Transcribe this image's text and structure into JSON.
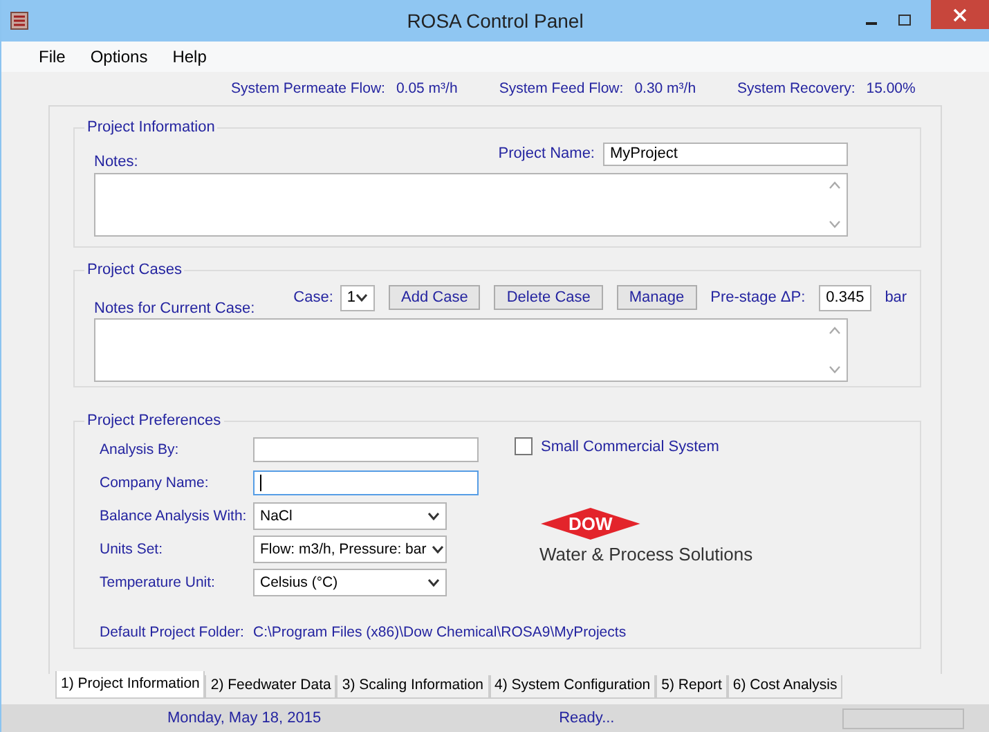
{
  "window": {
    "title": "ROSA Control Panel"
  },
  "menu": [
    "File",
    "Options",
    "Help"
  ],
  "summary": [
    {
      "label": "System Permeate Flow:",
      "value": "0.05 m³/h"
    },
    {
      "label": "System Feed Flow:",
      "value": "0.30 m³/h"
    },
    {
      "label": "System Recovery:",
      "value": "15.00%"
    }
  ],
  "project_information": {
    "title": "Project Information",
    "notes_label": "Notes:",
    "project_name_label": "Project Name:",
    "project_name": "MyProject"
  },
  "project_cases": {
    "title": "Project Cases",
    "notes_label": "Notes for Current Case:",
    "case_label": "Case:",
    "case": "1",
    "buttons": [
      "Add Case",
      "Delete Case",
      "Manage"
    ],
    "prestage_label": "Pre-stage ΔP:",
    "prestage_value": "0.345",
    "prestage_unit": "bar"
  },
  "project_preferences": {
    "title": "Project Preferences",
    "fields": [
      {
        "kind": "text",
        "label": "Analysis By:",
        "focused": false
      },
      {
        "kind": "text",
        "label": "Company Name:",
        "focused": true
      },
      {
        "kind": "select",
        "label": "Balance Analysis With:",
        "value": "NaCl"
      },
      {
        "kind": "select",
        "label": "Units Set:",
        "value": "Flow: m3/h, Pressure: bar"
      },
      {
        "kind": "select",
        "label": "Temperature Unit:",
        "value": "Celsius (°C)"
      },
      {
        "kind": "path",
        "label": "Default Project Folder:",
        "value": "C:\\Program Files (x86)\\Dow Chemical\\ROSA9\\MyProjects"
      }
    ],
    "small_commercial": {
      "label": "Small Commercial System",
      "checked": false
    }
  },
  "logo": {
    "text": "DOW",
    "tagline": "Water & Process Solutions"
  },
  "tabs": [
    {
      "label": "1) Project Information",
      "selected": true
    },
    {
      "label": "2) Feedwater Data",
      "selected": false
    },
    {
      "label": "3) Scaling Information",
      "selected": false
    },
    {
      "label": "4) System Configuration",
      "selected": false
    },
    {
      "label": "5) Report",
      "selected": false
    },
    {
      "label": "6) Cost Analysis",
      "selected": false
    }
  ],
  "status_bar": {
    "date": "Monday, May 18, 2015",
    "message": "Ready..."
  }
}
